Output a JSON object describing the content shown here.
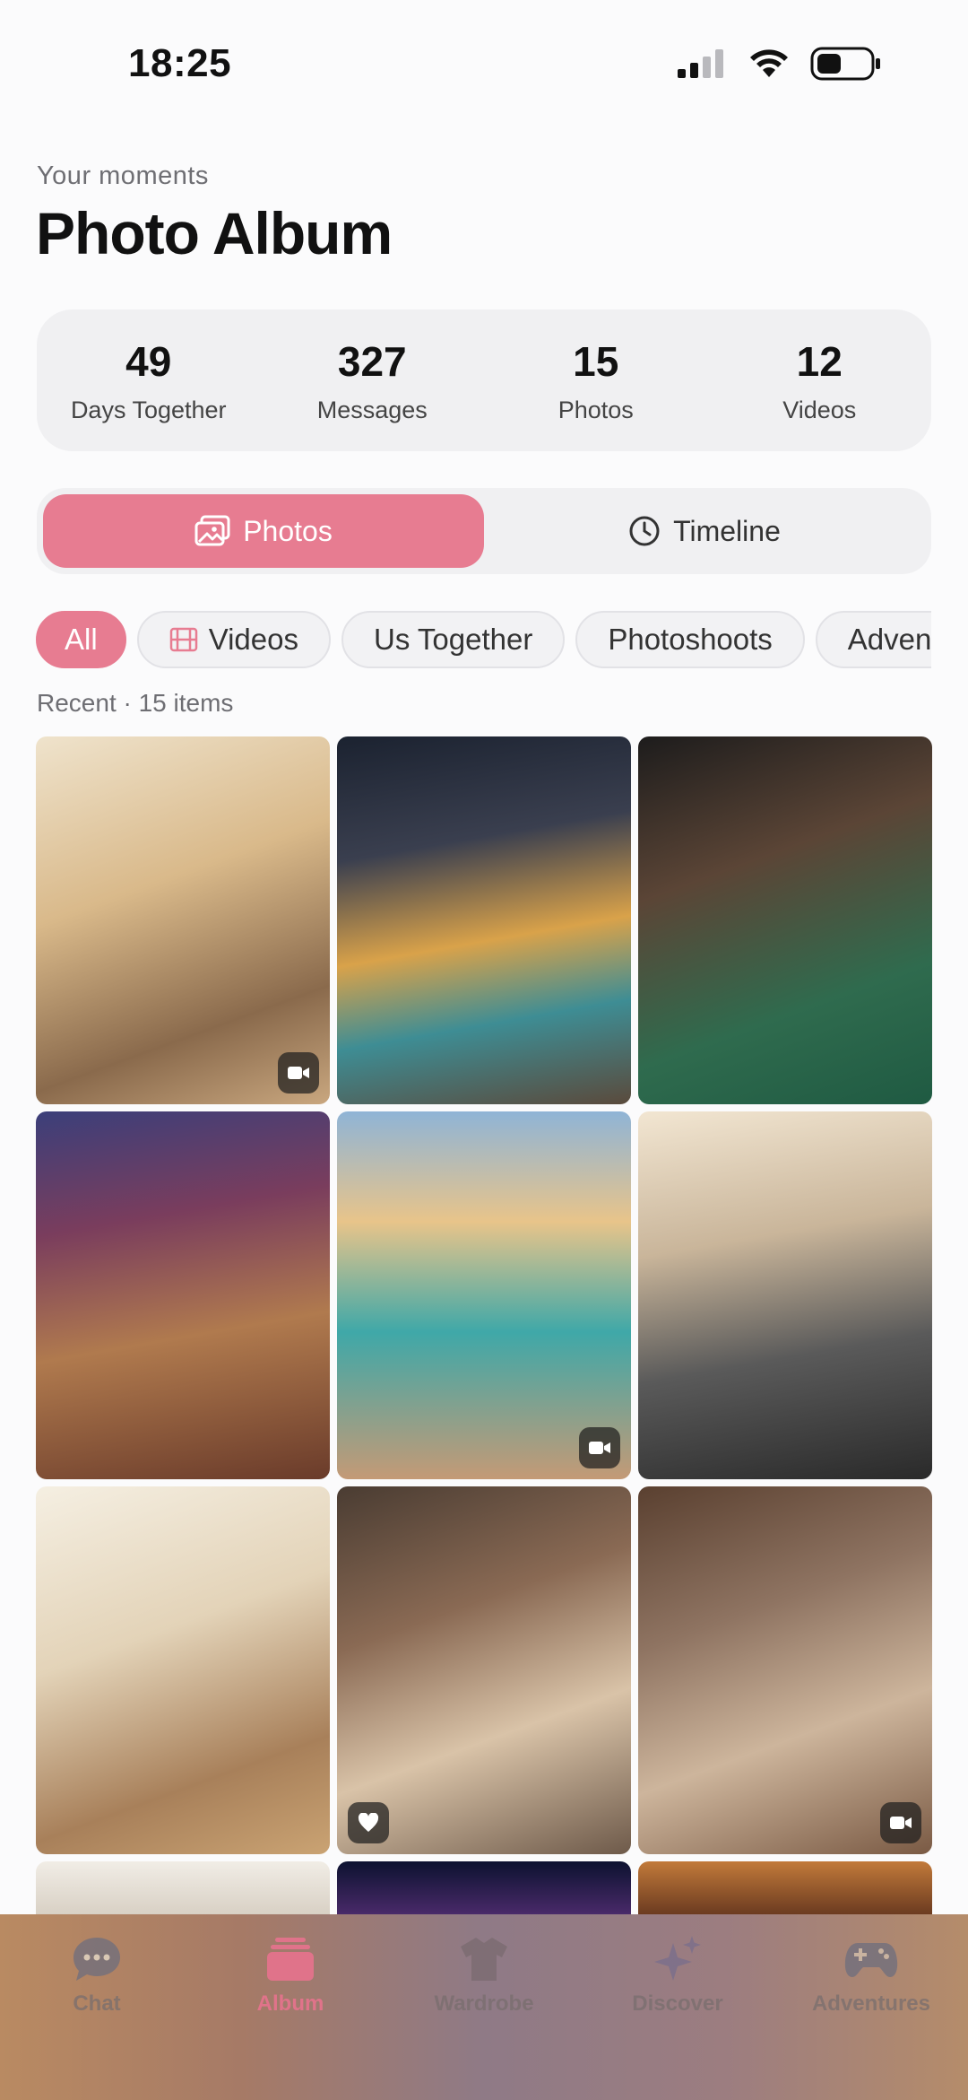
{
  "status_bar": {
    "time": "18:25"
  },
  "header": {
    "subtitle": "Your moments",
    "title": "Photo Album"
  },
  "stats": [
    {
      "value": "49",
      "label": "Days Together"
    },
    {
      "value": "327",
      "label": "Messages"
    },
    {
      "value": "15",
      "label": "Photos"
    },
    {
      "value": "12",
      "label": "Videos"
    }
  ],
  "view_toggle": {
    "photos_label": "Photos",
    "timeline_label": "Timeline",
    "selected": "Photos"
  },
  "filters": [
    {
      "label": "All",
      "active": true
    },
    {
      "label": "Videos",
      "icon": "film-icon"
    },
    {
      "label": "Us Together"
    },
    {
      "label": "Photoshoots"
    },
    {
      "label": "Adventures"
    }
  ],
  "section": {
    "label": "Recent · 15 items"
  },
  "photos": [
    {
      "name": "bathroom-towel",
      "badge": "video-icon"
    },
    {
      "name": "pool-party",
      "badge": ""
    },
    {
      "name": "billiards-group",
      "badge": ""
    },
    {
      "name": "bowling-pizza",
      "badge": ""
    },
    {
      "name": "beach-couple",
      "badge": "video-icon"
    },
    {
      "name": "motorcycle-selfie",
      "badge": ""
    },
    {
      "name": "kitchen-cooking",
      "badge": ""
    },
    {
      "name": "couple-selfie-bed",
      "badge": "heart-icon"
    },
    {
      "name": "couch-selfie",
      "badge": "video-icon"
    }
  ],
  "tab_bar": {
    "items": [
      {
        "label": "Chat",
        "icon": "chat-bubble-icon"
      },
      {
        "label": "Album",
        "icon": "album-stack-icon",
        "active": true
      },
      {
        "label": "Wardrobe",
        "icon": "shirt-icon"
      },
      {
        "label": "Discover",
        "icon": "sparkles-icon"
      },
      {
        "label": "Adventures",
        "icon": "gamepad-icon"
      }
    ]
  },
  "colors": {
    "accent": "#e77c91",
    "card_bg": "#f0f0f2",
    "text_secondary": "#6e6e73"
  }
}
